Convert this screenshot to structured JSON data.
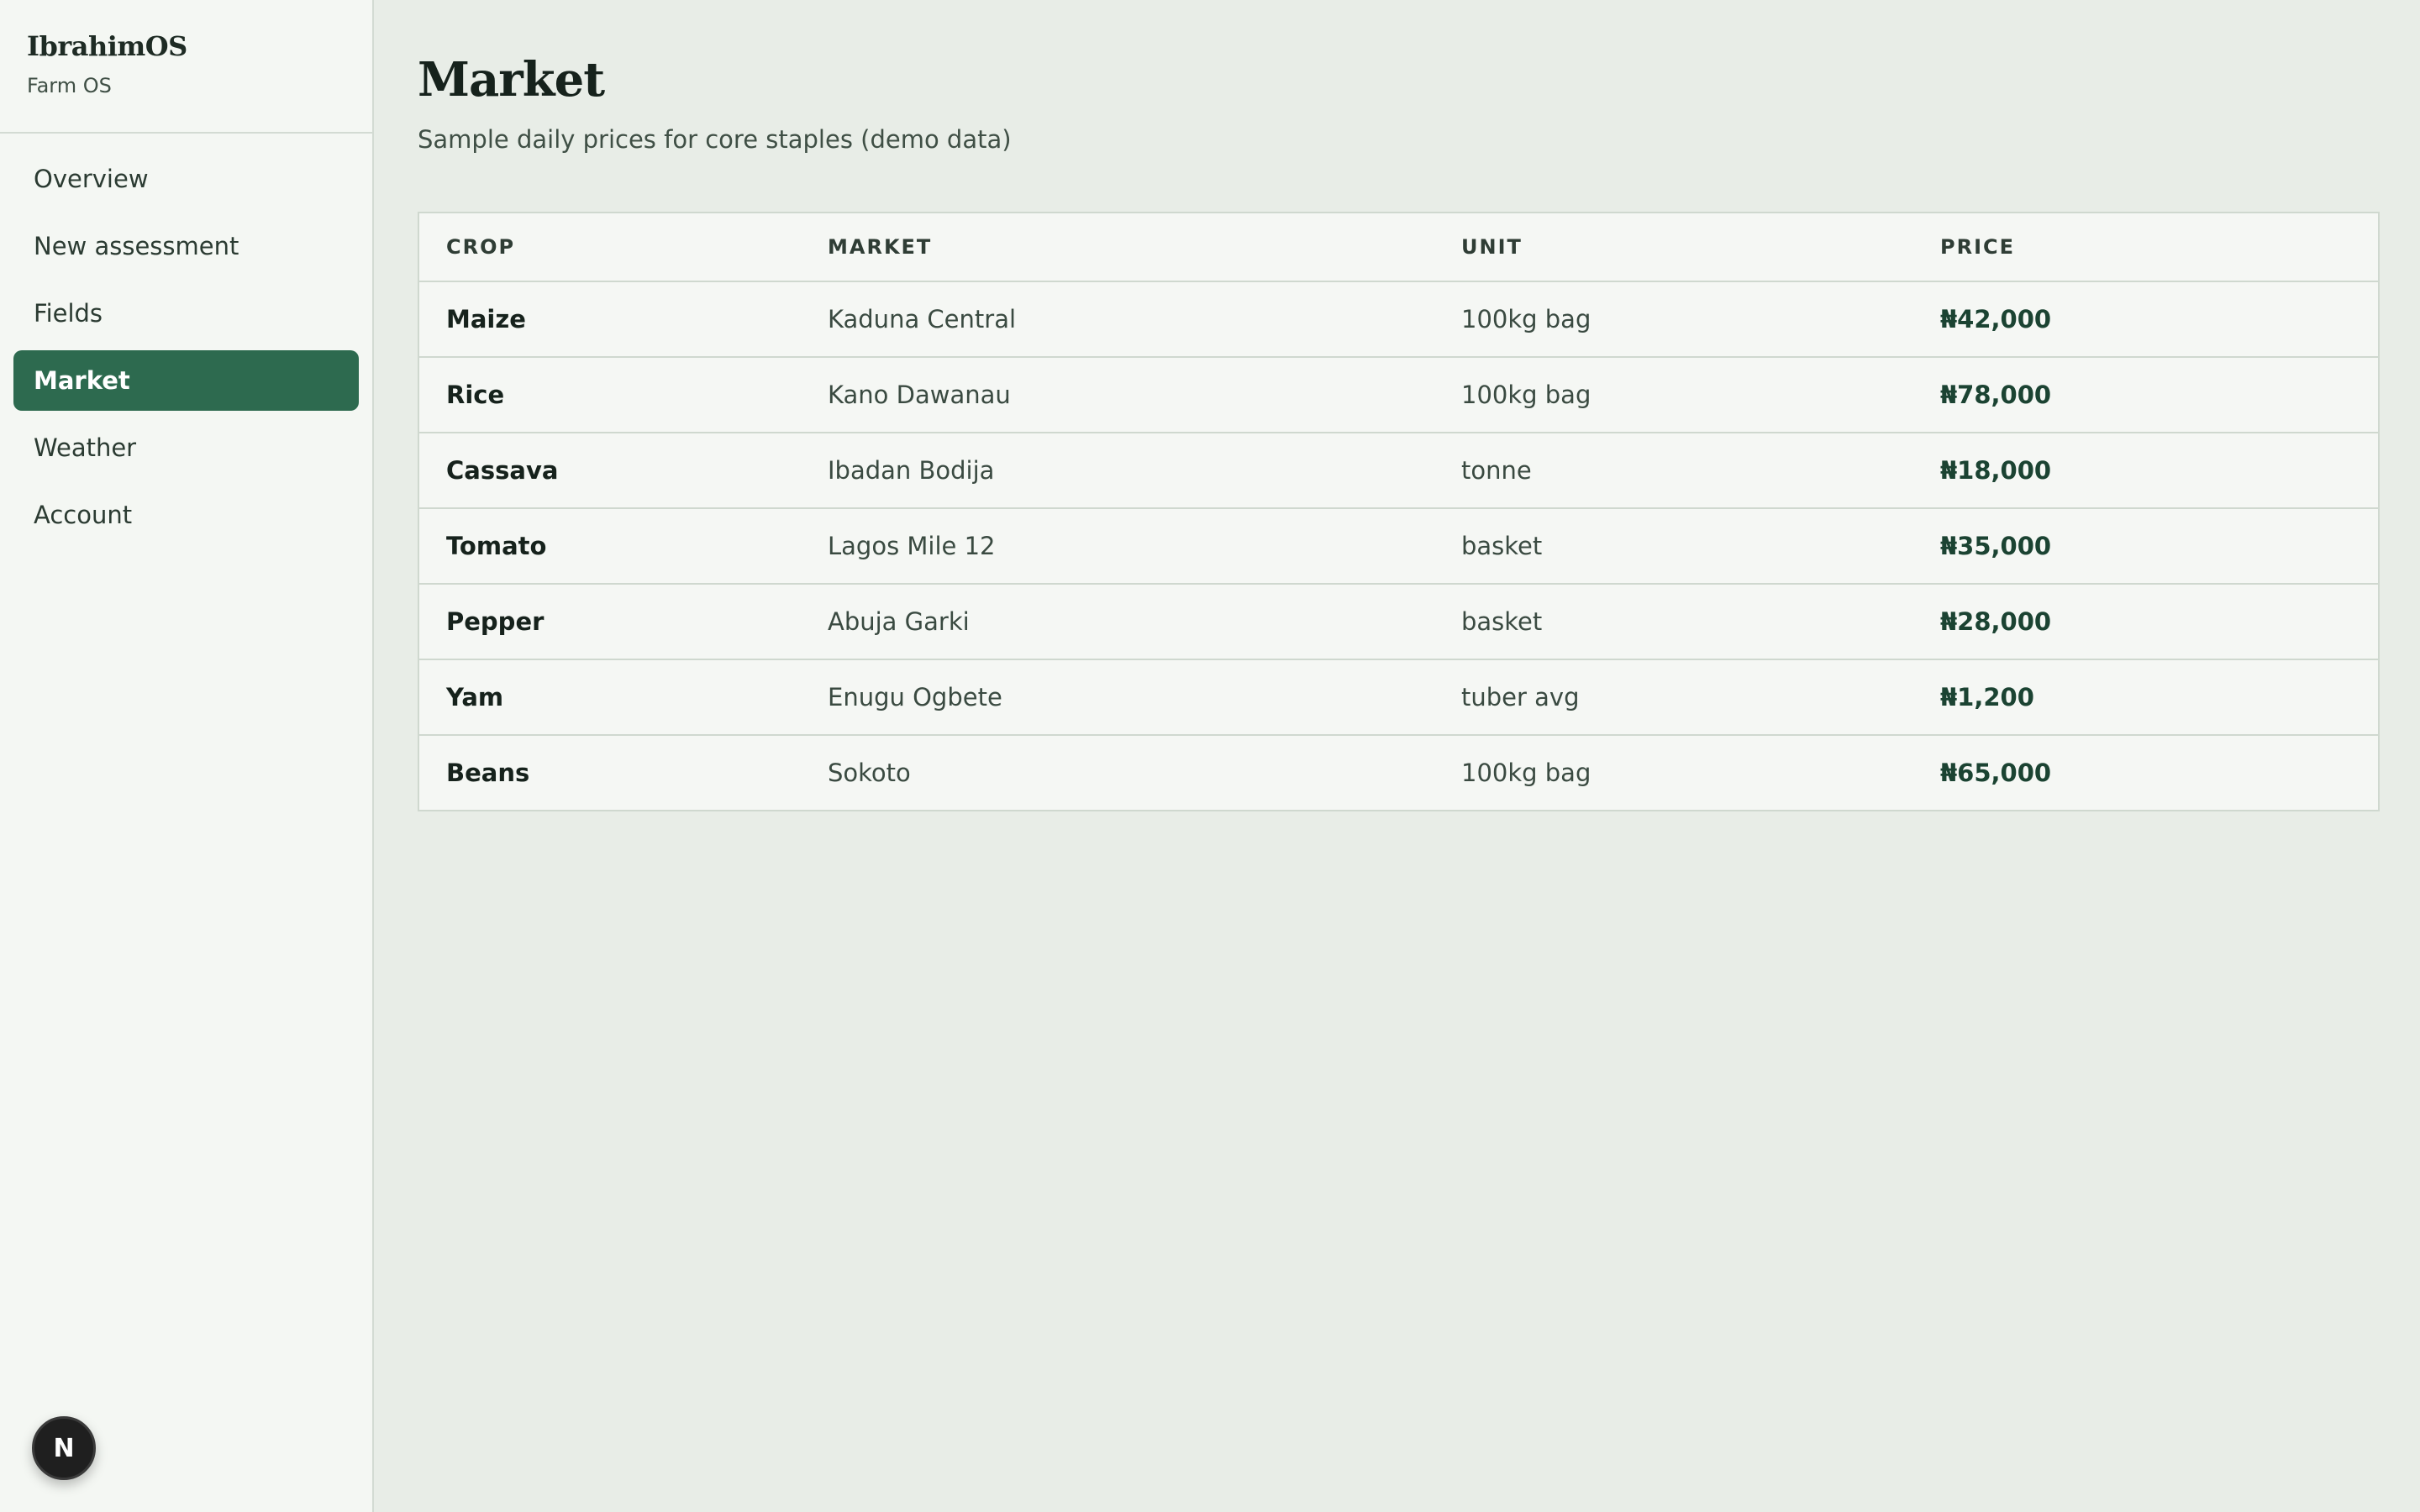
{
  "sidebar": {
    "brand_title": "IbrahimOS",
    "brand_subtitle": "Farm OS",
    "items": [
      {
        "label": "Overview"
      },
      {
        "label": "New assessment"
      },
      {
        "label": "Fields"
      },
      {
        "label": "Market",
        "active": true
      },
      {
        "label": "Weather"
      },
      {
        "label": "Account"
      }
    ],
    "avatar_letter": "N"
  },
  "main": {
    "title": "Market",
    "subtitle": "Sample daily prices for core staples (demo data)",
    "table": {
      "headers": [
        "CROP",
        "MARKET",
        "UNIT",
        "PRICE"
      ],
      "rows": [
        {
          "crop": "Maize",
          "market": "Kaduna Central",
          "unit": "100kg bag",
          "price": "₦42,000"
        },
        {
          "crop": "Rice",
          "market": "Kano Dawanau",
          "unit": "100kg bag",
          "price": "₦78,000"
        },
        {
          "crop": "Cassava",
          "market": "Ibadan Bodija",
          "unit": "tonne",
          "price": "₦18,000"
        },
        {
          "crop": "Tomato",
          "market": "Lagos Mile 12",
          "unit": "basket",
          "price": "₦35,000"
        },
        {
          "crop": "Pepper",
          "market": "Abuja Garki",
          "unit": "basket",
          "price": "₦28,000"
        },
        {
          "crop": "Yam",
          "market": "Enugu Ogbete",
          "unit": "tuber avg",
          "price": "₦1,200"
        },
        {
          "crop": "Beans",
          "market": "Sokoto",
          "unit": "100kg bag",
          "price": "₦65,000"
        }
      ]
    }
  },
  "colors": {
    "accent": "#2d6a4f",
    "background": "#e8ede7",
    "sidebar_bg": "#f4f7f3"
  }
}
